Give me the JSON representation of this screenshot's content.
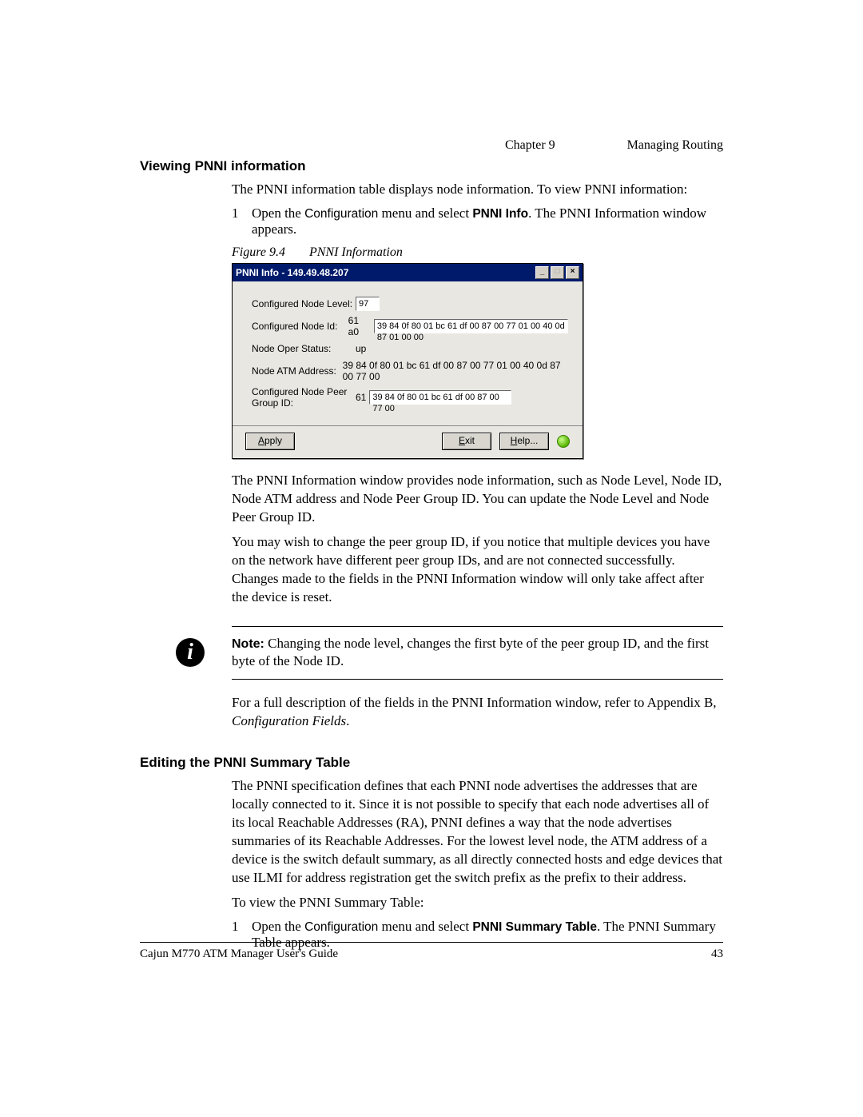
{
  "header": {
    "chapter": "Chapter 9",
    "title": "Managing Routing"
  },
  "section1": {
    "heading": "Viewing PNNI information",
    "intro": "The PNNI information table displays node information. To view PNNI information:",
    "step1_num": "1",
    "step1_a": "Open the ",
    "step1_b": "Configuration",
    "step1_c": " menu and select ",
    "step1_d": "PNNI Info",
    "step1_e": ". The PNNI Information window appears.",
    "figcap_label": "Figure 9.4",
    "figcap_text": "PNNI Information",
    "para1": "The PNNI Information window provides node information, such as Node Level, Node ID, Node ATM address and Node Peer Group ID. You can update the Node Level and Node Peer Group ID.",
    "para2": "You may wish to change the peer group ID, if you notice that multiple devices you have on the network have different peer group IDs, and are not connected successfully. Changes made to the fields in the PNNI Information window will only take affect after the device is reset.",
    "note_bold": "Note:",
    "note_text": "  Changing the node level, changes the first byte of the peer group ID, and the first byte of the Node ID.",
    "para3_a": "For a full description of the fields in the PNNI Information window, refer to Appendix B, ",
    "para3_b": "Configuration Fields",
    "para3_c": "."
  },
  "dialog": {
    "title": "PNNI Info - 149.49.48.207",
    "labels": {
      "level": "Configured Node Level:",
      "id": "Configured Node Id:",
      "status": "Node Oper Status:",
      "atm": "Node ATM Address:",
      "peer": "Configured Node Peer Group ID:"
    },
    "values": {
      "level_box": "97",
      "id_prefix": "61 a0",
      "id_box": "39 84 0f 80 01 bc 61 df 00 87 00 77 01 00 40 0d 87 01 00 00",
      "status": "up",
      "atm": "39 84 0f 80 01 bc 61 df 00 87 00 77 01 00 40 0d 87 00 77 00",
      "peer_prefix": "61",
      "peer_box": "39 84 0f 80 01 bc 61 df 00 87 00 77 00"
    },
    "buttons": {
      "apply_u": "A",
      "apply_r": "pply",
      "exit_u": "E",
      "exit_r": "xit",
      "help_u": "H",
      "help_r": "elp..."
    }
  },
  "section2": {
    "heading": "Editing the PNNI Summary Table",
    "para1": "The PNNI specification defines that each PNNI node advertises the addresses that are locally connected to it. Since it is not possible to specify that each node advertises all of its local Reachable Addresses (RA), PNNI defines a way that the node advertises summaries of its Reachable Addresses. For the lowest level node, the ATM address of a device is the switch default summary, as all directly connected hosts and edge devices that use ILMI for address registration get the switch prefix as the prefix to their address.",
    "para2": "To view the PNNI Summary Table:",
    "step1_num": "1",
    "step1_a": "Open the ",
    "step1_b": "Configuration",
    "step1_c": " menu and select ",
    "step1_d": "PNNI Summary Table",
    "step1_e": ". The PNNI Summary Table appears."
  },
  "footer": {
    "left": "Cajun M770 ATM Manager User's Guide",
    "right": "43"
  }
}
